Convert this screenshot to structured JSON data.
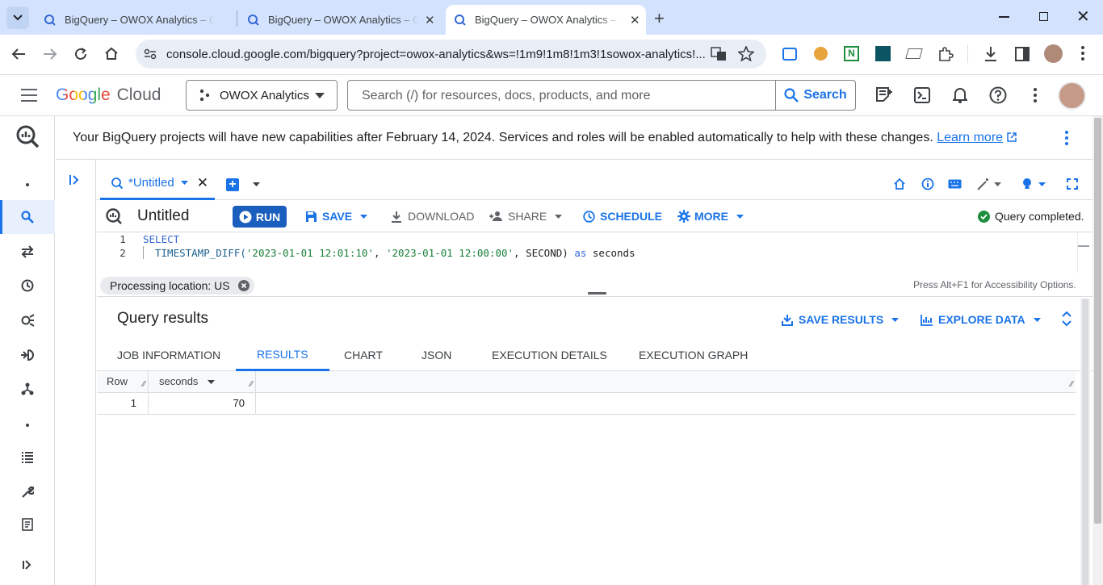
{
  "browser": {
    "tabs": [
      {
        "title": "BigQuery – OWOX Analytics – Google Cloud console"
      },
      {
        "title": "BigQuery – OWOX Analytics – Google Cloud console"
      },
      {
        "title": "BigQuery – OWOX Analytics – Google Cloud console"
      }
    ],
    "url": "console.cloud.google.com/bigquery?project=owox-analytics&ws=!1m9!1m8!1m3!1sowox-analytics!..."
  },
  "header": {
    "logo_google": "Google",
    "logo_cloud": "Cloud",
    "project": "OWOX Analytics",
    "search_placeholder": "Search (/) for resources, docs, products, and more",
    "search_button": "Search"
  },
  "banner": {
    "message": "Your BigQuery projects will have new capabilities after February 14, 2024. Services and roles will be enabled automatically to help with these changes.",
    "link": "Learn more"
  },
  "editor": {
    "tab_label": "*Untitled",
    "title": "Untitled",
    "actions": {
      "run": "RUN",
      "save": "SAVE",
      "download": "DOWNLOAD",
      "share": "SHARE",
      "schedule": "SCHEDULE",
      "more": "MORE"
    },
    "status": "Query completed.",
    "code": [
      {
        "num": "1",
        "text": "SELECT"
      },
      {
        "num": "2",
        "text": "  TIMESTAMP_DIFF('2023-01-01 12:01:10', '2023-01-01 12:00:00', SECOND) as seconds"
      }
    ],
    "code_parts": {
      "fn": "TIMESTAMP_DIFF(",
      "str1": "'2023-01-01 12:01:10'",
      "sep1": ", ",
      "str2": "'2023-01-01 12:00:00'",
      "rest": ", SECOND) ",
      "as": "as",
      "alias": " seconds"
    },
    "processing_location": "Processing location: US",
    "accessibility_hint": "Press Alt+F1 for Accessibility Options."
  },
  "results": {
    "title": "Query results",
    "save_results": "SAVE RESULTS",
    "explore_data": "EXPLORE DATA",
    "tabs": [
      "JOB INFORMATION",
      "RESULTS",
      "CHART",
      "JSON",
      "EXECUTION DETAILS",
      "EXECUTION GRAPH"
    ],
    "active_tab": "RESULTS",
    "columns": [
      "Row",
      "seconds"
    ],
    "rows": [
      [
        "1",
        "70"
      ]
    ]
  }
}
